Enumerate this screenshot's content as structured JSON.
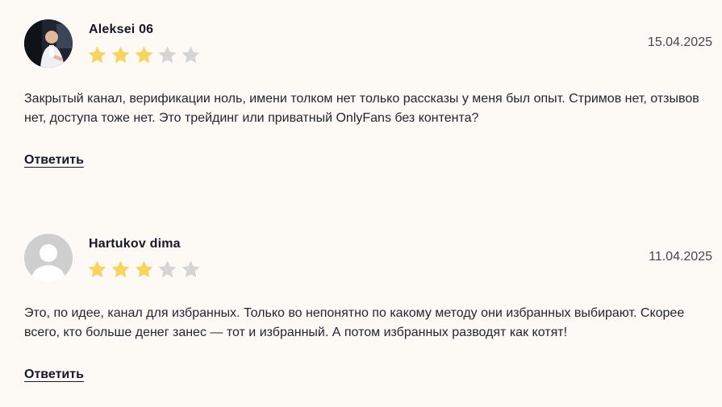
{
  "reviews": [
    {
      "author": "Aleksei 06",
      "date": "15.04.2025",
      "rating": 3,
      "max_rating": 5,
      "text": "Закрытый канал, верификации ноль, имени толком нет только рассказы у меня был опыт. Стримов нет, отзывов нет, доступа тоже нет. Это трейдинг или приватный OnlyFans без контента?",
      "reply_label": "Ответить",
      "avatar": "user-photo-avatar"
    },
    {
      "author": "Hartukov dima",
      "date": "11.04.2025",
      "rating": 3,
      "max_rating": 5,
      "text": "Это, по идее, канал для избранных. Только во непонятно по какому методу они избранных выбирают. Скорее всего, кто больше денег занес — тот и избранный. А потом избранных разводят как котят!",
      "reply_label": "Ответить",
      "avatar": "default-user-avatar"
    }
  ],
  "colors": {
    "background": "#fdfaf6",
    "star_filled": "#f8d45c",
    "star_empty": "#d5d5d5",
    "default_avatar_bg": "#cfcfcf"
  }
}
